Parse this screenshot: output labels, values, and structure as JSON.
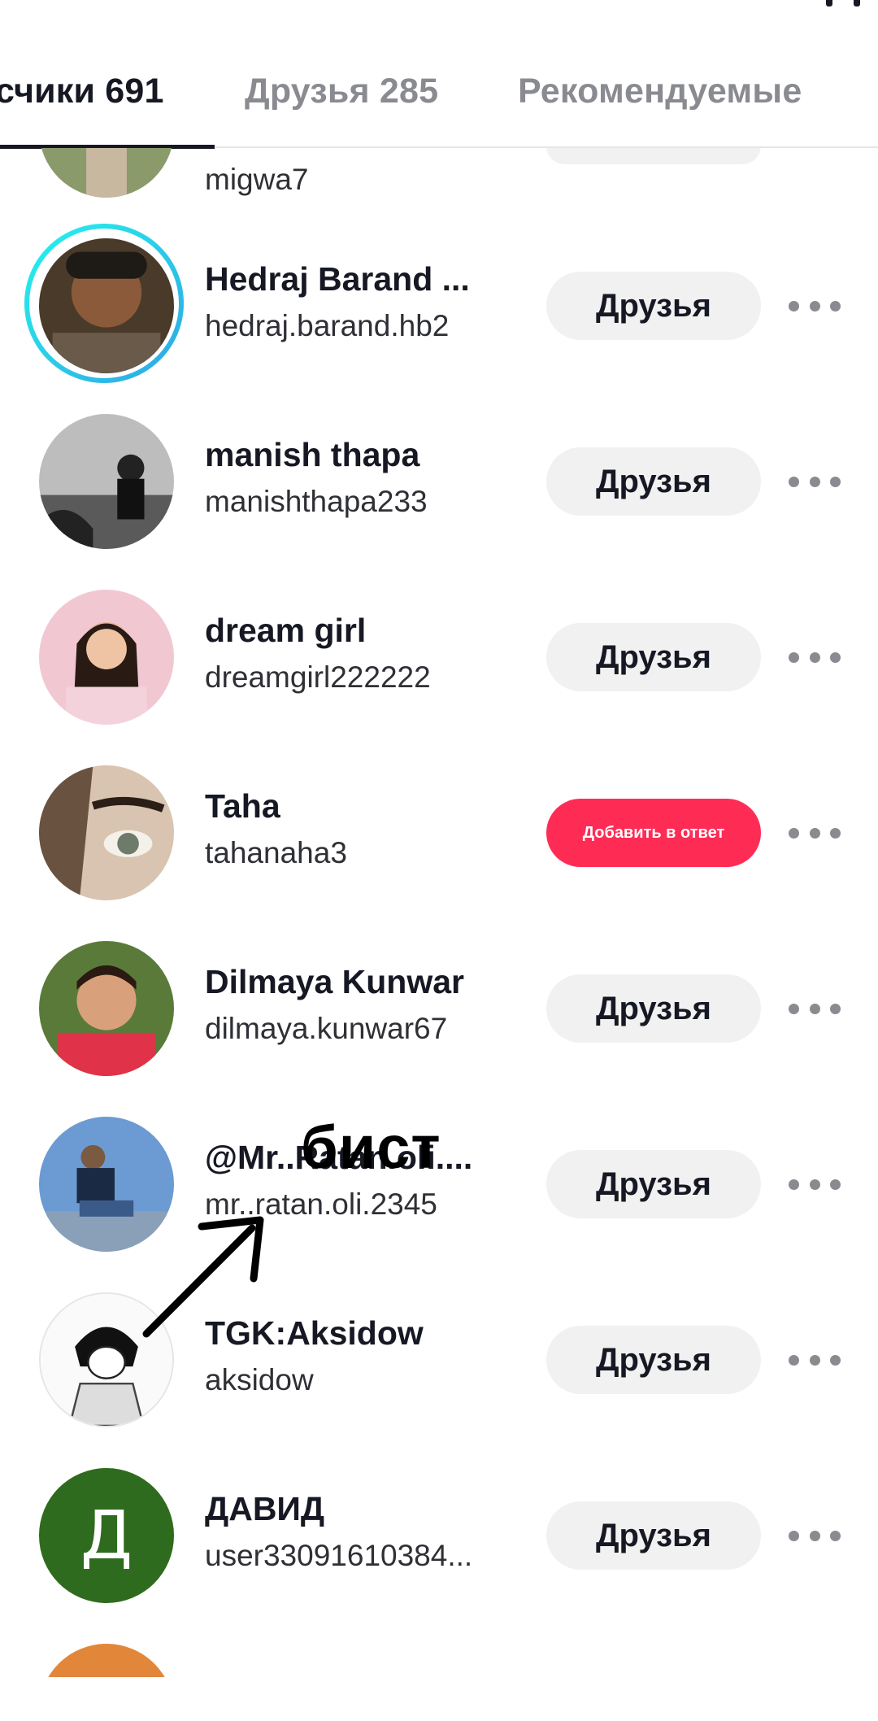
{
  "tabs": {
    "followers": "счики 691",
    "friends": "Друзья 285",
    "suggested": "Рекомендуемые"
  },
  "partial_top": {
    "handle": "migwa7"
  },
  "users": [
    {
      "name": "Hedraj Barand ...",
      "handle": "hedraj.barand.hb2",
      "button": "Друзья",
      "has_story": true,
      "avatar_color": "#6b4a32"
    },
    {
      "name": "manish thapa",
      "handle": "manishthapa233",
      "button": "Друзья",
      "has_story": false,
      "avatar_color": "#777777"
    },
    {
      "name": "dream girl",
      "handle": "dreamgirl222222",
      "button": "Друзья",
      "has_story": false,
      "avatar_color": "#e8b7c2"
    },
    {
      "name": "Taha",
      "handle": "tahanaha3",
      "button": "Добавить в ответ",
      "has_story": false,
      "avatar_color": "#c9b7a3",
      "primary": true
    },
    {
      "name": "Dilmaya Kunwar",
      "handle": "dilmaya.kunwar67",
      "button": "Друзья",
      "has_story": false,
      "avatar_color": "#d83a4a"
    },
    {
      "name": "@Mr..Ratan.oli....",
      "handle": "mr..ratan.oli.2345",
      "button": "Друзья",
      "has_story": false,
      "avatar_color": "#5b8fc9"
    },
    {
      "name": "TGK:Aksidow",
      "handle": "aksidow",
      "button": "Друзья",
      "has_story": false,
      "avatar_color": "#f7f7f7"
    },
    {
      "name": "ДАВИД",
      "handle": "user33091610384...",
      "button": "Друзья",
      "has_story": false,
      "avatar_color": "#2f6b1e",
      "avatar_letter": "Д"
    }
  ],
  "overlay": {
    "text": "бист"
  },
  "colors": {
    "primary_button": "#fe2c55",
    "secondary_button": "#f1f1f2",
    "story_ring": "#25f4ee"
  }
}
